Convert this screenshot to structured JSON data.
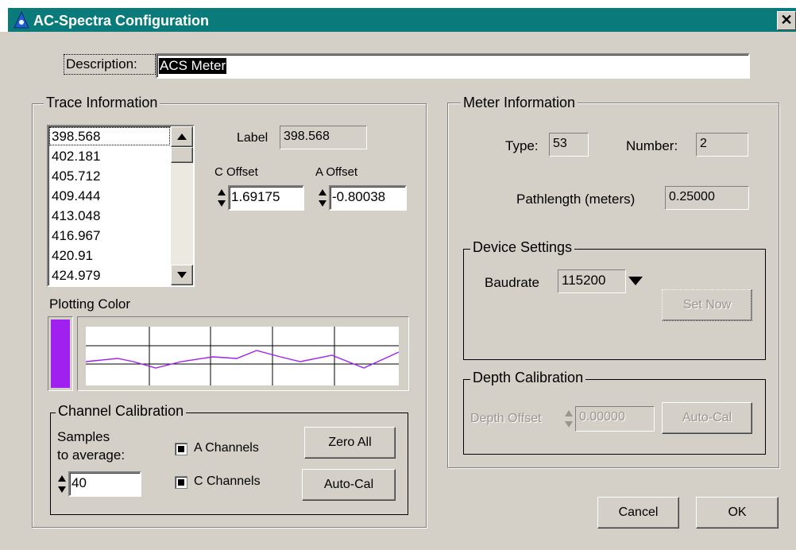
{
  "window": {
    "title": "AC-Spectra Configuration",
    "close_glyph": "✕"
  },
  "description": {
    "label": "Description:",
    "value": "ACS Meter"
  },
  "trace": {
    "group_label": "Trace Information",
    "list_items": [
      "398.568",
      "402.181",
      "405.712",
      "409.444",
      "413.048",
      "416.967",
      "420.91",
      "424.979"
    ],
    "selected_index": 0,
    "label_caption": "Label",
    "label_value": "398.568",
    "c_offset_label": "C Offset",
    "c_offset_value": "1.69175",
    "a_offset_label": "A Offset",
    "a_offset_value": "-0.80038",
    "plotting_color_label": "Plotting Color",
    "plot_color": "#a020f0"
  },
  "channel_calibration": {
    "group_label": "Channel Calibration",
    "samples_label_line1": "Samples",
    "samples_label_line2": "to average:",
    "samples_value": "40",
    "a_channels_label": "A Channels",
    "a_channels_checked": true,
    "c_channels_label": "C Channels",
    "c_channels_checked": true,
    "zero_all_label": "Zero All",
    "auto_cal_label": "Auto-Cal"
  },
  "meter": {
    "group_label": "Meter Information",
    "type_label": "Type:",
    "type_value": "53",
    "number_label": "Number:",
    "number_value": "2",
    "pathlength_label": "Pathlength (meters)",
    "pathlength_value": "0.25000"
  },
  "device_settings": {
    "group_label": "Device Settings",
    "baudrate_label": "Baudrate",
    "baudrate_value": "115200",
    "set_now_label": "Set Now"
  },
  "depth_calibration": {
    "group_label": "Depth Calibration",
    "depth_offset_label": "Depth Offset",
    "depth_offset_value": "0.00000",
    "auto_cal_label": "Auto-Cal"
  },
  "footer": {
    "cancel_label": "Cancel",
    "ok_label": "OK"
  }
}
